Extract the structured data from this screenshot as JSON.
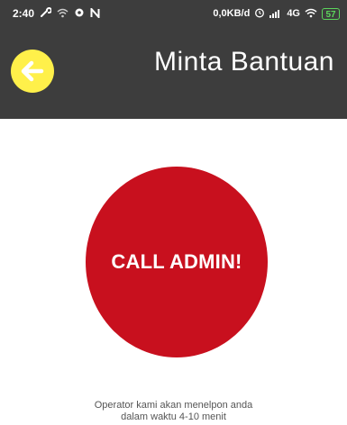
{
  "status_bar": {
    "time": "2:40",
    "network_speed": "0,0KB/d",
    "network_type": "4G",
    "battery_level": "57",
    "icons_left": [
      "wrench-icon",
      "wifi-icon",
      "location-icon",
      "n-icon"
    ],
    "icons_right": [
      "alarm-icon",
      "signal-icon",
      "wifi-icon",
      "battery-icon"
    ]
  },
  "app_bar": {
    "title": "Minta Bantuan",
    "back_icon": "arrow-left-icon",
    "background_color": "#3d3d3d",
    "back_button_color": "#fff04a"
  },
  "main": {
    "call_button_label": "CALL ADMIN!",
    "call_button_color": "#c8101e",
    "info_line_1": "Operator kami akan menelpon anda",
    "info_line_2": "dalam waktu 4-10 menit"
  }
}
